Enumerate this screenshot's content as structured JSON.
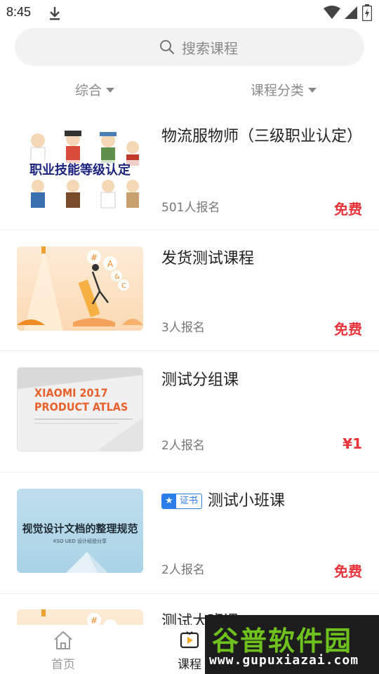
{
  "status_bar": {
    "time": "8:45"
  },
  "search": {
    "placeholder": "搜索课程"
  },
  "filters": [
    {
      "label": "综合"
    },
    {
      "label": "课程分类"
    }
  ],
  "courses": [
    {
      "title": "物流服物师（三级职业认定）",
      "enrolled": "501人报名",
      "price": "免费",
      "thumb_text": "职业技能等级认定"
    },
    {
      "title": "发货测试课程",
      "enrolled": "3人报名",
      "price": "免费"
    },
    {
      "title": "测试分组课",
      "enrolled": "2人报名",
      "price": "¥1",
      "thumb_line1": "XIAOMI 2017",
      "thumb_line2": "PRODUCT ATLAS"
    },
    {
      "badge": "证书",
      "title": "测试小班课",
      "enrolled": "2人报名",
      "price": "免费",
      "thumb_text": "视觉设计文档的整理规范",
      "thumb_sub": "KSO UED 设计经验分享"
    },
    {
      "title": "测试大班课"
    }
  ],
  "bottom_nav": [
    {
      "label": "首页",
      "icon": "home-icon",
      "active": false
    },
    {
      "label": "课程",
      "icon": "course-play-icon",
      "active": true
    }
  ],
  "watermark": {
    "title": "谷普软件园",
    "url": "www.gupuxiazai.com"
  },
  "colors": {
    "price": "#e8333a",
    "badge": "#2b7de9",
    "watermark_green": "#6fc21e"
  }
}
